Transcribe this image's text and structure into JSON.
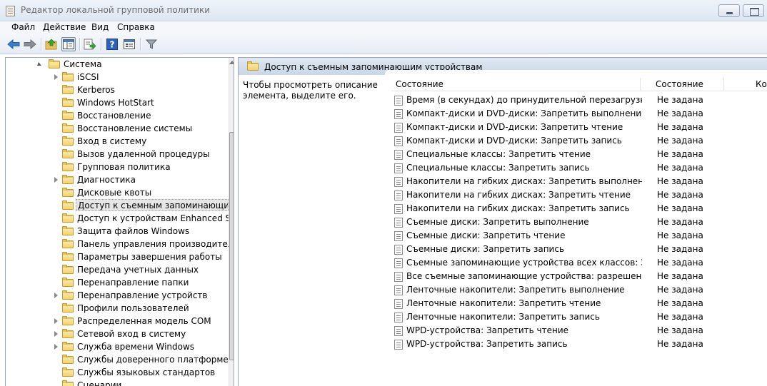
{
  "window": {
    "title": "Редактор локальной групповой политики"
  },
  "menu": [
    "Файл",
    "Действие",
    "Вид",
    "Справка"
  ],
  "toolbar": {
    "buttons": [
      "back-icon",
      "forward-icon",
      "up-folder-icon",
      "show-hide-tree-icon",
      "export-list-icon",
      "help-icon",
      "properties-icon",
      "filter-icon"
    ]
  },
  "tree": {
    "parent": "Система",
    "items": [
      {
        "label": "iSCSI",
        "expandable": true
      },
      {
        "label": "Kerberos",
        "expandable": false
      },
      {
        "label": "Windows HotStart",
        "expandable": false
      },
      {
        "label": "Восстановление",
        "expandable": false
      },
      {
        "label": "Восстановление системы",
        "expandable": false
      },
      {
        "label": "Вход в систему",
        "expandable": false
      },
      {
        "label": "Вызов удаленной процедуры",
        "expandable": false
      },
      {
        "label": "Групповая политика",
        "expandable": false
      },
      {
        "label": "Диагностика",
        "expandable": true
      },
      {
        "label": "Дисковые квоты",
        "expandable": false
      },
      {
        "label": "Доступ к съемным запоминающим у",
        "expandable": false,
        "selected": true
      },
      {
        "label": "Доступ к устройствам Enhanced Stora",
        "expandable": false
      },
      {
        "label": "Защита файлов Windows",
        "expandable": false
      },
      {
        "label": "Панель управления производитель",
        "expandable": false
      },
      {
        "label": "Параметры завершения работы",
        "expandable": false
      },
      {
        "label": "Передача учетных данных",
        "expandable": false
      },
      {
        "label": "Перенаправление папки",
        "expandable": false
      },
      {
        "label": "Перенаправление устройств",
        "expandable": true
      },
      {
        "label": "Профили пользователей",
        "expandable": false
      },
      {
        "label": "Распределенная модель COM",
        "expandable": true
      },
      {
        "label": "Сетевой вход в систему",
        "expandable": true
      },
      {
        "label": "Служба времени Windows",
        "expandable": true
      },
      {
        "label": "Службы доверенного платформенно",
        "expandable": false
      },
      {
        "label": "Службы языковых стандартов",
        "expandable": false
      },
      {
        "label": "Сценарии",
        "expandable": false
      }
    ]
  },
  "right": {
    "header_title": "Доступ к съемным запоминающим устройствам",
    "description": "Чтобы просмотреть описание элемента, выделите его.",
    "columns": [
      "Состояние",
      "Состояние",
      "Ком"
    ],
    "rows": [
      {
        "name": "Время (в секундах) до принудительной перезагрузки",
        "state": "Не задана"
      },
      {
        "name": "Компакт-диски и DVD-диски: Запретить выполнение",
        "state": "Не задана"
      },
      {
        "name": "Компакт-диски и DVD-диски: Запретить чтение",
        "state": "Не задана"
      },
      {
        "name": "Компакт-диски и DVD-диски: Запретить запись",
        "state": "Не задана"
      },
      {
        "name": "Специальные классы: Запретить чтение",
        "state": "Не задана"
      },
      {
        "name": "Специальные классы: Запретить запись",
        "state": "Не задана"
      },
      {
        "name": "Накопители на гибких дисках: Запретить выполнение",
        "state": "Не задана"
      },
      {
        "name": "Накопители на гибких дисках: Запретить чтение",
        "state": "Не задана"
      },
      {
        "name": "Накопители на гибких дисках: Запретить запись",
        "state": "Не задана"
      },
      {
        "name": "Съемные диски: Запретить выполнение",
        "state": "Не задана"
      },
      {
        "name": "Съемные диски: Запретить чтение",
        "state": "Не задана"
      },
      {
        "name": "Съемные диски: Запретить запись",
        "state": "Не задана"
      },
      {
        "name": "Съемные запоминающие устройства всех классов: Запр...",
        "state": "Не задана"
      },
      {
        "name": "Все съемные запоминающие устройства: разрешение п...",
        "state": "Не задана"
      },
      {
        "name": "Ленточные накопители: Запретить выполнение",
        "state": "Не задана"
      },
      {
        "name": "Ленточные накопители: Запретить чтение",
        "state": "Не задана"
      },
      {
        "name": "Ленточные накопители: Запретить запись",
        "state": "Не задана"
      },
      {
        "name": "WPD-устройства: Запретить чтение",
        "state": "Не задана"
      },
      {
        "name": "WPD-устройства: Запретить запись",
        "state": "Не задана"
      }
    ]
  }
}
